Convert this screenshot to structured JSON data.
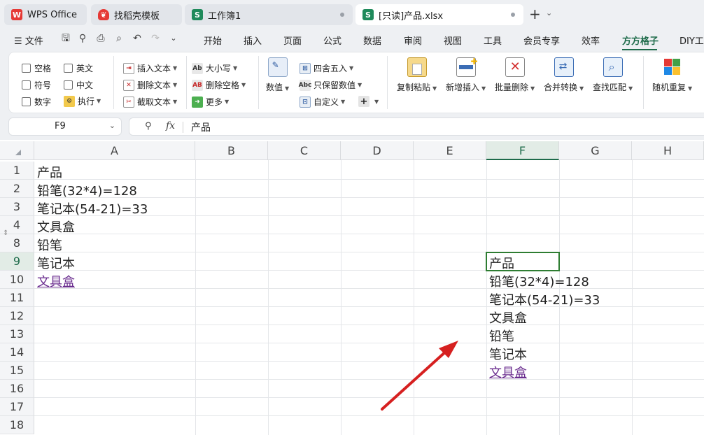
{
  "tabs": [
    {
      "label": "WPS Office",
      "icon": "wps-logo-icon"
    },
    {
      "label": "找稻壳模板",
      "icon": "docer-icon"
    },
    {
      "label": "工作簿1",
      "icon": "spreadsheet-icon"
    },
    {
      "label": "[只读]产品.xlsx",
      "icon": "spreadsheet-icon"
    }
  ],
  "menu": {
    "file": "文件",
    "items": [
      "开始",
      "插入",
      "页面",
      "公式",
      "数据",
      "审阅",
      "视图",
      "工具",
      "会员专享",
      "效率",
      "方方格子",
      "DIY工"
    ],
    "active": "方方格子"
  },
  "ribbon": {
    "checkboxes": [
      "空格",
      "英文",
      "符号",
      "中文",
      "数字"
    ],
    "exec": "执行",
    "text_tools": [
      "插入文本",
      "删除文本",
      "截取文本"
    ],
    "case_tools": [
      "大小写",
      "删除空格",
      "更多"
    ],
    "number": "数值",
    "round_tools": [
      "四舍五入",
      "只保留数值",
      "自定义"
    ],
    "plus": "+",
    "big_buttons": [
      "复制粘贴",
      "新增插入",
      "批量删除",
      "合并转换",
      "查找匹配",
      "随机重复"
    ]
  },
  "formula_bar": {
    "name_box": "F9",
    "fx": "fx",
    "value": "产品"
  },
  "grid": {
    "columns": [
      "A",
      "B",
      "C",
      "D",
      "E",
      "F",
      "G",
      "H"
    ],
    "selected_column": "F",
    "rows": [
      "1",
      "2",
      "3",
      "4",
      "8",
      "9",
      "10",
      "11",
      "12",
      "13",
      "14",
      "15",
      "16",
      "17",
      "18"
    ],
    "selected_row": "9",
    "selected_cell": "F9",
    "column_a": [
      "产品",
      "铅笔(32*4)=128",
      "笔记本(54-21)=33",
      "文具盒",
      "铅笔",
      "笔记本",
      "文具盒"
    ],
    "column_f": [
      "产品",
      "铅笔(32*4)=128",
      "笔记本(54-21)=33",
      "文具盒",
      "铅笔",
      "笔记本",
      "文具盒"
    ]
  },
  "colors": {
    "accent": "#1e6b4a",
    "selection_border": "#2e7d32",
    "link": "#6b2e8f",
    "annotation_arrow": "#d62020"
  }
}
